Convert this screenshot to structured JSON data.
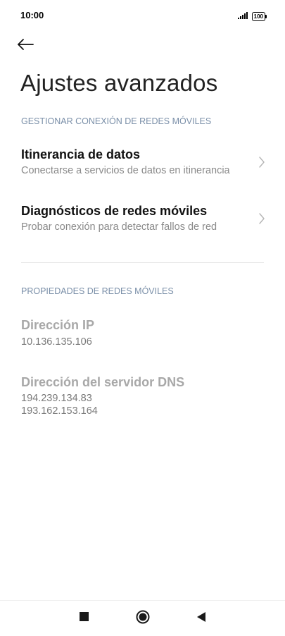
{
  "status_bar": {
    "time": "10:00",
    "battery": "100",
    "icons": [
      "signal-icon",
      "battery-icon"
    ]
  },
  "header": {
    "back_icon": "arrow-left-icon",
    "title": "Ajustes avanzados"
  },
  "sections": {
    "manage": {
      "header": "GESTIONAR CONEXIÓN DE REDES MÓVILES",
      "items": [
        {
          "title": "Itinerancia de datos",
          "subtitle": "Conectarse a servicios de datos en itinerancia",
          "icon": "chevron-right-icon"
        },
        {
          "title": "Diagnósticos de redes móviles",
          "subtitle": "Probar conexión para detectar fallos de red",
          "icon": "chevron-right-icon"
        }
      ]
    },
    "properties": {
      "header": "PROPIEDADES DE REDES MÓVILES",
      "ip": {
        "title": "Dirección IP",
        "values": [
          "10.136.135.106"
        ]
      },
      "dns": {
        "title": "Dirección del servidor DNS",
        "values": [
          "194.239.134.83",
          "193.162.153.164"
        ]
      }
    }
  },
  "nav_bar": {
    "buttons": [
      "recents-square-icon",
      "home-circle-icon",
      "back-triangle-icon"
    ]
  },
  "colors": {
    "section_header": "#7a8fa8",
    "disabled_title": "#a8a8a8",
    "subtitle": "#8a8a8a"
  }
}
